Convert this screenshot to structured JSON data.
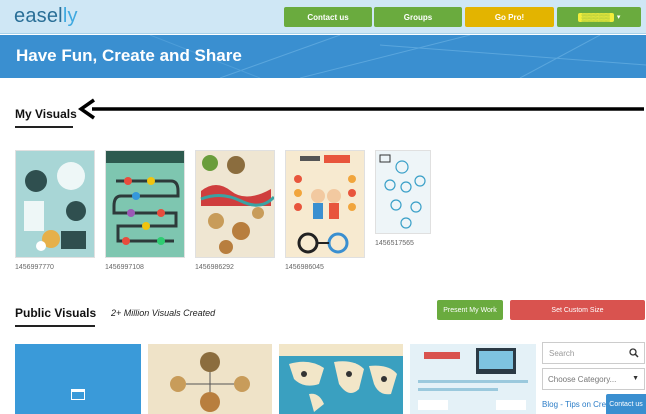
{
  "app": {
    "logo_main": "easel",
    "logo_accent": "ly"
  },
  "nav": {
    "contact_label": "Contact us",
    "groups_label": "Groups",
    "gopro_label": "Go Pro!",
    "user_label": "▒▒▒▒▒"
  },
  "banner": {
    "title": "Have Fun, Create and Share"
  },
  "my_visuals": {
    "title": "My Visuals",
    "items": [
      {
        "caption": "1456997770"
      },
      {
        "caption": "1456997108"
      },
      {
        "caption": "1456986292"
      },
      {
        "caption": "1456986045"
      },
      {
        "caption": "1456517565"
      }
    ]
  },
  "public_visuals": {
    "title": "Public Visuals",
    "count_text": "2+ Million Visuals Created",
    "present_label": "Present My Work",
    "custom_size_label": "Set Custom Size",
    "search_placeholder": "Search",
    "category_placeholder": "Choose Category...",
    "blog_link": "Blog - Tips on Crea",
    "contact_tab": "Contact us"
  },
  "colors": {
    "nav_green": "#6aab3e",
    "gopro_yellow": "#e3b400",
    "banner_blue": "#3a8fd0",
    "custom_red": "#d9534f"
  }
}
